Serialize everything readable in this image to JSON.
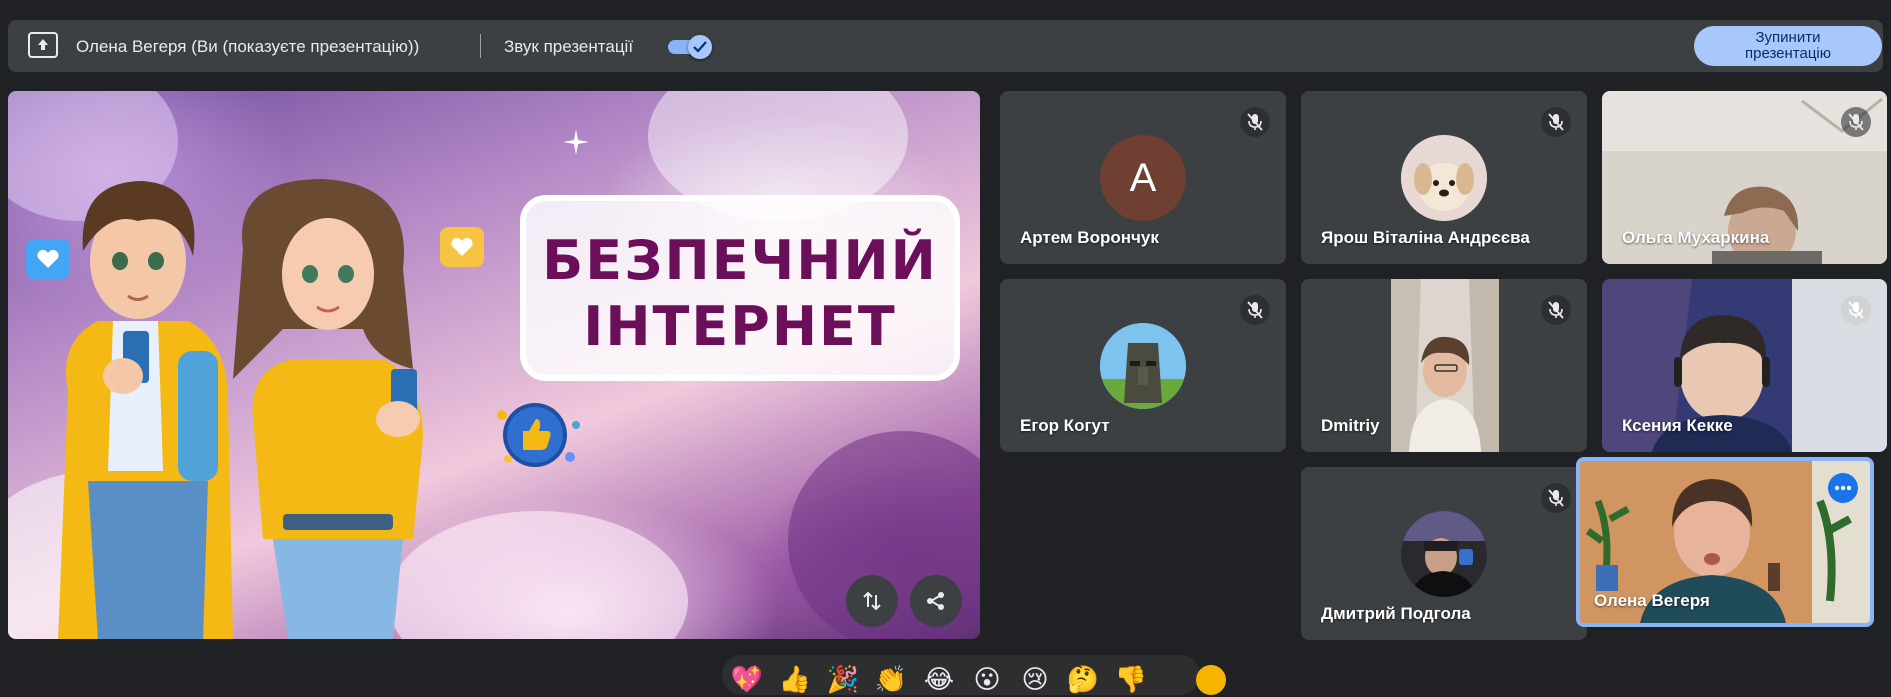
{
  "topbar": {
    "presenter_text": "Олена Вегеря (Ви (показуєте презентацію))",
    "sound_label": "Звук презентації",
    "sound_enabled": true,
    "stop_button": "Зупинити презентацію"
  },
  "slide": {
    "title_line1": "БЕЗПЕЧНИЙ",
    "title_line2": "ІНТЕРНЕТ"
  },
  "participants": [
    {
      "name": "Артем Ворончук",
      "type": "letter",
      "letter": "A",
      "muted": true
    },
    {
      "name": "Ярош Віталіна Андрєєва",
      "type": "avatar",
      "muted": true
    },
    {
      "name": "Ольга Мухаркина",
      "type": "video",
      "muted": true
    },
    {
      "name": "Егор Когут",
      "type": "avatar",
      "muted": true
    },
    {
      "name": "Dmitriy",
      "type": "video",
      "muted": true
    },
    {
      "name": "Ксения Кекке",
      "type": "video",
      "muted": true
    },
    {
      "name": "Дмитрий Подгола",
      "type": "avatar",
      "muted": true
    },
    {
      "name": "Олена Вегеря",
      "type": "video",
      "self": true
    }
  ],
  "reactions": [
    "💖",
    "👍",
    "🎉",
    "👏",
    "😂",
    "😮",
    "😢",
    "🤔",
    "👎"
  ],
  "colors": {
    "accent": "#a8c7fa",
    "tile_bg": "#3c4043",
    "page_bg": "#202124",
    "self_border": "#8ab4f8",
    "title_text": "#6b0f5a"
  }
}
